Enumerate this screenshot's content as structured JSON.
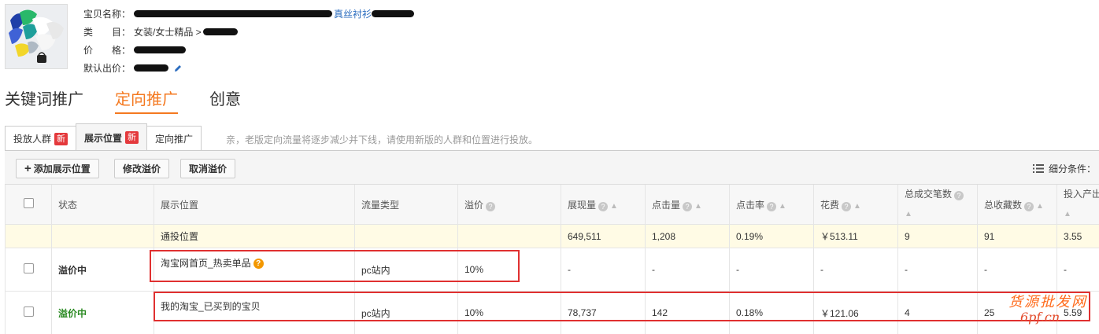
{
  "product": {
    "name_label": "宝贝名称：",
    "name_tail": "真丝衬衫",
    "category_label": "类　　目：",
    "category_value": "女装/女士精品 >",
    "price_label": "价　　格：",
    "bid_label": "默认出价："
  },
  "main_tabs": [
    {
      "label": "关键词推广",
      "active": false
    },
    {
      "label": "定向推广",
      "active": true
    },
    {
      "label": "创意",
      "active": false
    }
  ],
  "sub_tabs": [
    {
      "label": "投放人群",
      "badge": "新",
      "active": false
    },
    {
      "label": "展示位置",
      "badge": "新",
      "active": true
    },
    {
      "label": "定向推广",
      "badge": "",
      "active": false
    }
  ],
  "notice": "亲，老版定向流量将逐步减少并下线，请使用新版的人群和位置进行投放。",
  "toolbar": {
    "add_label": "添加展示位置",
    "modify_label": "修改溢价",
    "cancel_label": "取消溢价",
    "filter_label": "细分条件："
  },
  "table": {
    "headers": {
      "status": "状态",
      "position": "展示位置",
      "traffic": "流量类型",
      "premium": "溢价",
      "impressions": "展现量",
      "clicks": "点击量",
      "ctr": "点击率",
      "cost": "花费",
      "deals": "总成交笔数",
      "favorites": "总收藏数",
      "roi": "投入产出"
    },
    "summary": {
      "position": "通投位置",
      "impressions": "649,511",
      "clicks": "1,208",
      "ctr": "0.19%",
      "cost": "￥513.11",
      "deals": "9",
      "favorites": "91",
      "roi": "3.55"
    },
    "rows": [
      {
        "status": "溢价中",
        "position": "淘宝网首页_热卖单品",
        "traffic": "pc站内",
        "premium": "10%",
        "impressions": "-",
        "clicks": "-",
        "ctr": "-",
        "cost": "-",
        "deals": "-",
        "favorites": "-",
        "roi": "-"
      },
      {
        "status": "溢价中",
        "position": "我的淘宝_已买到的宝贝",
        "traffic": "pc站内",
        "premium": "10%",
        "impressions": "78,737",
        "clicks": "142",
        "ctr": "0.18%",
        "cost": "￥121.06",
        "deals": "4",
        "favorites": "25",
        "roi": "5.59"
      }
    ]
  },
  "watermark": {
    "line1": "货源批发网",
    "line2": "6pf.cn"
  },
  "colors": {
    "accent_orange": "#f47920",
    "status_green": "#2a8a22",
    "badge_red": "#e4393c",
    "highlight_red": "#e03030",
    "summary_bg": "#fffbe5"
  }
}
